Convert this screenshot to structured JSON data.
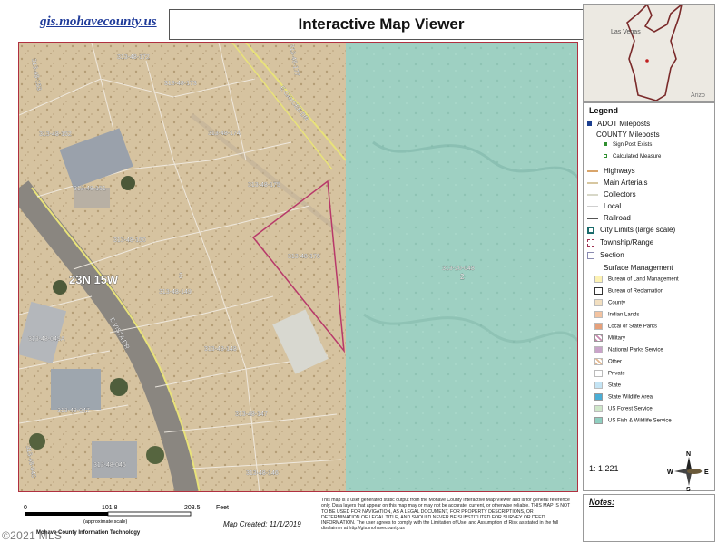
{
  "header": {
    "site_link": "gis.mohavecounty.us",
    "title": "Interactive Map Viewer"
  },
  "map": {
    "parcels": [
      "313-48-172",
      "313-48-173",
      "313-48-177",
      "313-48-174",
      "313-48-152",
      "313-48-175",
      "313-48-151",
      "313-48-150",
      "313-48-176",
      "313-20-048",
      "313-48-149",
      "313-48-049A",
      "313-48-148",
      "313-48-047",
      "313-48-147",
      "313-48-046",
      "313-48-146",
      "313-48-153",
      "313-48-045"
    ],
    "roads": [
      "E CAYCEE DR",
      "E VISTA DR"
    ],
    "township": "23N 15W",
    "section_numbers": [
      "3",
      "2"
    ]
  },
  "overview": {
    "place_label": "Las Vegas",
    "city_label": "Arizo"
  },
  "legend": {
    "title": "Legend",
    "items": [
      {
        "label": "ADOT Mileposts",
        "color": "#1c3f8f"
      },
      {
        "label": "COUNTY Mileposts",
        "color": ""
      },
      {
        "label": "Sign Post Exists",
        "color": "#2f8f2f"
      },
      {
        "label": "Calculated Measure",
        "color": "#2f8f2f"
      },
      {
        "label": "Highways",
        "color": "#d9a56b"
      },
      {
        "label": "Main Arterials",
        "color": "#d7c7a0"
      },
      {
        "label": "Collectors",
        "color": "#d8d8c8"
      },
      {
        "label": "Local",
        "color": "#cfcfcf"
      },
      {
        "label": "Railroad",
        "color": "#555555"
      },
      {
        "label": "City Limits (large scale)",
        "color": "#1a6b6b"
      },
      {
        "label": "Township/Range",
        "color": "#a03050"
      },
      {
        "label": "Section",
        "color": "#8a8ab0"
      },
      {
        "label": "Surface Management",
        "color": ""
      },
      {
        "label": "Bureau of Land Management",
        "color": "#fdf2b3"
      },
      {
        "label": "Bureau of Reclamation",
        "color": "#ffffff"
      },
      {
        "label": "County",
        "color": "#f2dfc0"
      },
      {
        "label": "Indian Lands",
        "color": "#f3c3a0"
      },
      {
        "label": "Local or State Parks",
        "color": "#e6a07a"
      },
      {
        "label": "Military",
        "color": "#c98ab0"
      },
      {
        "label": "National Parks Service",
        "color": "#c9a4c9"
      },
      {
        "label": "Other",
        "color": "#e3b890"
      },
      {
        "label": "Private",
        "color": "#ffffff"
      },
      {
        "label": "State",
        "color": "#c4e4f4"
      },
      {
        "label": "State Wildlife Area",
        "color": "#4aaed6"
      },
      {
        "label": "US Forest Service",
        "color": "#cfe7c9"
      },
      {
        "label": "US Fish & Wildlife Service",
        "color": "#8fcfc0"
      }
    ],
    "scale": "1: 1,221",
    "compass": {
      "n": "N",
      "s": "S",
      "e": "E",
      "w": "W"
    }
  },
  "footer": {
    "scale_ticks": [
      "0",
      "101.8",
      "203.5"
    ],
    "scale_unit": "Feet",
    "scale_note": "(approximate scale)",
    "created": "Map Created: 11/1/2019",
    "org": "Mohave County Information Technology",
    "disclaimer": "This map is a user generated static output from the Mohave County Interactive Map Viewer and is for general reference only. Data layers that appear on this map may or may not be accurate, current, or otherwise reliable. THIS MAP IS NOT TO BE USED FOR NAVIGATION, AS A LEGAL DOCUMENT, FOR PROPERTY DESCRIPTIONS, OR DETERMINATION OF LEGAL TITLE, AND SHOULD NEVER BE SUBSTITUTED FOR SURVEY OR DEED INFORMATION. The user agrees to comply with the Limitation of Use, and Assumption of Risk as stated in the full disclaimer at http://gis.mohavecounty.us"
  },
  "notes": {
    "label": "Notes:"
  },
  "copyright": "©2021 MLS"
}
